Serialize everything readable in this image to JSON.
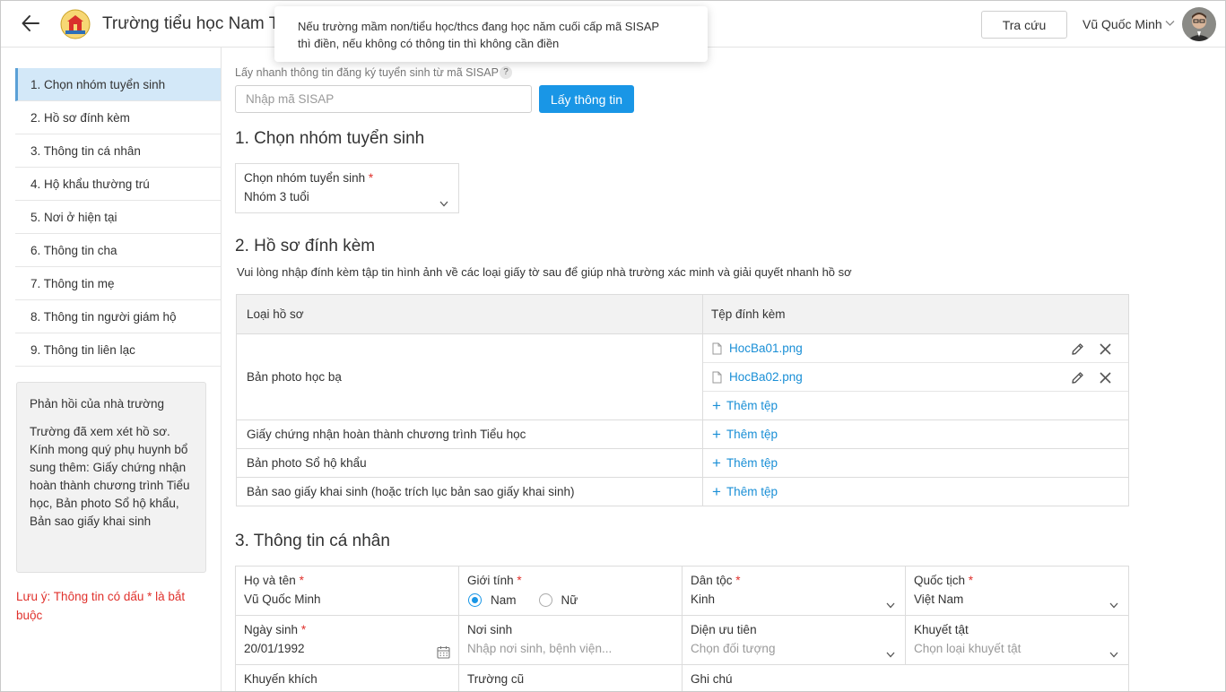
{
  "header": {
    "title": "Trường tiểu học Nam Trun",
    "lookup_label": "Tra cứu",
    "user_name": "Vũ Quốc Minh"
  },
  "tooltip": {
    "line1": "Nếu trường mầm non/tiểu học/thcs đang học năm cuối cấp mã SISAP",
    "line2": "thì điền, nếu không có thông tin thì không cần điền"
  },
  "sidebar": {
    "items": [
      {
        "label": "1. Chọn nhóm tuyển sinh"
      },
      {
        "label": "2. Hồ sơ đính kèm"
      },
      {
        "label": "3. Thông tin cá nhân"
      },
      {
        "label": "4. Hộ khẩu thường trú"
      },
      {
        "label": "5. Nơi ở hiện tại"
      },
      {
        "label": "6. Thông tin cha"
      },
      {
        "label": "7. Thông tin mẹ"
      },
      {
        "label": "8. Thông tin người giám hộ"
      },
      {
        "label": "9. Thông tin liên lạc"
      }
    ],
    "feedback_title": "Phản hồi của nhà trường",
    "feedback_body": "Trường đã xem xét hồ sơ. Kính mong quý phụ huynh bổ sung thêm: Giấy chứng nhận hoàn thành chương trình Tiểu học, Bản photo Sổ hộ khẩu, Bản sao giấy khai sinh",
    "note": "Lưu ý: Thông tin có dấu * là bắt buộc"
  },
  "sisap": {
    "label": "Lấy nhanh thông tin đăng ký tuyển sinh từ mã SISAP",
    "help": "?",
    "placeholder": "Nhập mã SISAP",
    "button": "Lấy thông tin"
  },
  "section1": {
    "title": "1. Chọn nhóm tuyển sinh",
    "field_label": "Chọn nhóm tuyển sinh",
    "required": "*",
    "value": "Nhóm 3 tuổi"
  },
  "section2": {
    "title": "2. Hồ sơ đính kèm",
    "description": "Vui lòng nhập đính kèm tập tin hình ảnh về các loại giấy tờ sau để giúp nhà trường xác minh và giải quyết nhanh hồ sơ",
    "col_type": "Loại hồ sơ",
    "col_file": "Tệp đính kèm",
    "add_label": "Thêm tệp",
    "rows": [
      {
        "type": "Bản photo học bạ",
        "files": [
          "HocBa01.png",
          "HocBa02.png"
        ]
      },
      {
        "type": "Giấy chứng nhận hoàn thành chương trình Tiểu học"
      },
      {
        "type": "Bản photo Sổ hộ khẩu"
      },
      {
        "type": "Bản sao giấy khai sinh (hoặc trích lục bản sao giấy khai sinh)"
      }
    ]
  },
  "section3": {
    "title": "3. Thông tin cá nhân",
    "full_name": {
      "label": "Họ và tên",
      "value": "Vũ Quốc Minh"
    },
    "gender": {
      "label": "Giới tính",
      "options": [
        "Nam",
        "Nữ"
      ],
      "selected": "Nam"
    },
    "ethnicity": {
      "label": "Dân tộc",
      "value": "Kinh"
    },
    "nationality": {
      "label": "Quốc tịch",
      "value": "Việt Nam"
    },
    "birth_date": {
      "label": "Ngày sinh",
      "value": "20/01/1992"
    },
    "birth_place": {
      "label": "Nơi sinh",
      "placeholder": "Nhập nơi sinh, bệnh viện..."
    },
    "priority": {
      "label": "Diện ưu tiên",
      "placeholder": "Chọn đối tượng"
    },
    "disability": {
      "label": "Khuyết tật",
      "placeholder": "Chọn loại khuyết tật"
    },
    "encouragement": {
      "label": "Khuyến khích"
    },
    "old_school": {
      "label": "Trường cũ"
    },
    "note": {
      "label": "Ghi chú"
    }
  },
  "colors": {
    "accent": "#1996e6",
    "active_bg": "#d3e8f8",
    "required": "#e0312c",
    "link": "#1a8fd6"
  }
}
